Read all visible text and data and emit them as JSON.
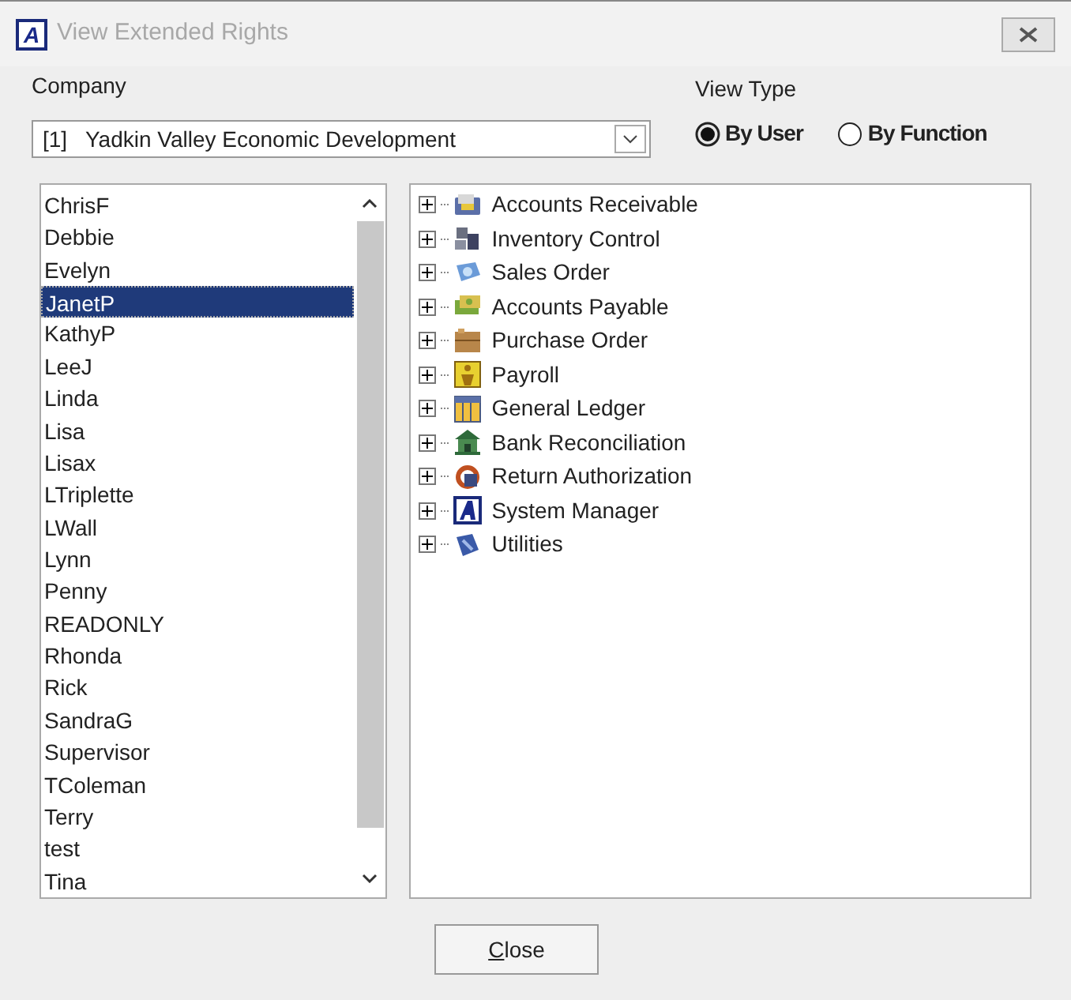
{
  "window": {
    "title": "View Extended Rights",
    "app_icon": "A"
  },
  "company": {
    "label": "Company",
    "value": "[1]   Yadkin Valley Economic Development"
  },
  "view_type": {
    "label": "View Type",
    "options": [
      {
        "label": "By User",
        "selected": true
      },
      {
        "label": "By Function",
        "selected": false
      }
    ]
  },
  "users": [
    {
      "name": "ChrisF",
      "selected": false
    },
    {
      "name": "Debbie",
      "selected": false
    },
    {
      "name": "Evelyn",
      "selected": false
    },
    {
      "name": "JanetP",
      "selected": true
    },
    {
      "name": "KathyP",
      "selected": false
    },
    {
      "name": "LeeJ",
      "selected": false
    },
    {
      "name": "Linda",
      "selected": false
    },
    {
      "name": "Lisa",
      "selected": false
    },
    {
      "name": "Lisax",
      "selected": false
    },
    {
      "name": "LTriplette",
      "selected": false
    },
    {
      "name": "LWall",
      "selected": false
    },
    {
      "name": "Lynn",
      "selected": false
    },
    {
      "name": "Penny",
      "selected": false
    },
    {
      "name": "READONLY",
      "selected": false
    },
    {
      "name": "Rhonda",
      "selected": false
    },
    {
      "name": "Rick",
      "selected": false
    },
    {
      "name": "SandraG",
      "selected": false
    },
    {
      "name": "Supervisor",
      "selected": false
    },
    {
      "name": "TColeman",
      "selected": false
    },
    {
      "name": "Terry",
      "selected": false
    },
    {
      "name": "test",
      "selected": false
    },
    {
      "name": "Tina",
      "selected": false
    }
  ],
  "modules": [
    {
      "label": "Accounts Receivable",
      "kind": "receivable",
      "expanded": false
    },
    {
      "label": "Inventory Control",
      "kind": "inventory",
      "expanded": false
    },
    {
      "label": "Sales Order",
      "kind": "sales",
      "expanded": false
    },
    {
      "label": "Accounts Payable",
      "kind": "payable",
      "expanded": false
    },
    {
      "label": "Purchase Order",
      "kind": "purchase",
      "expanded": false
    },
    {
      "label": "Payroll",
      "kind": "payroll",
      "expanded": false
    },
    {
      "label": "General Ledger",
      "kind": "ledger",
      "expanded": false
    },
    {
      "label": "Bank Reconciliation",
      "kind": "bank",
      "expanded": false
    },
    {
      "label": "Return Authorization",
      "kind": "return",
      "expanded": false
    },
    {
      "label": "System Manager",
      "kind": "system",
      "expanded": false
    },
    {
      "label": "Utilities",
      "kind": "utilities",
      "expanded": false
    }
  ],
  "close_button": {
    "label": "Close",
    "mnemonic_underlined": true
  }
}
